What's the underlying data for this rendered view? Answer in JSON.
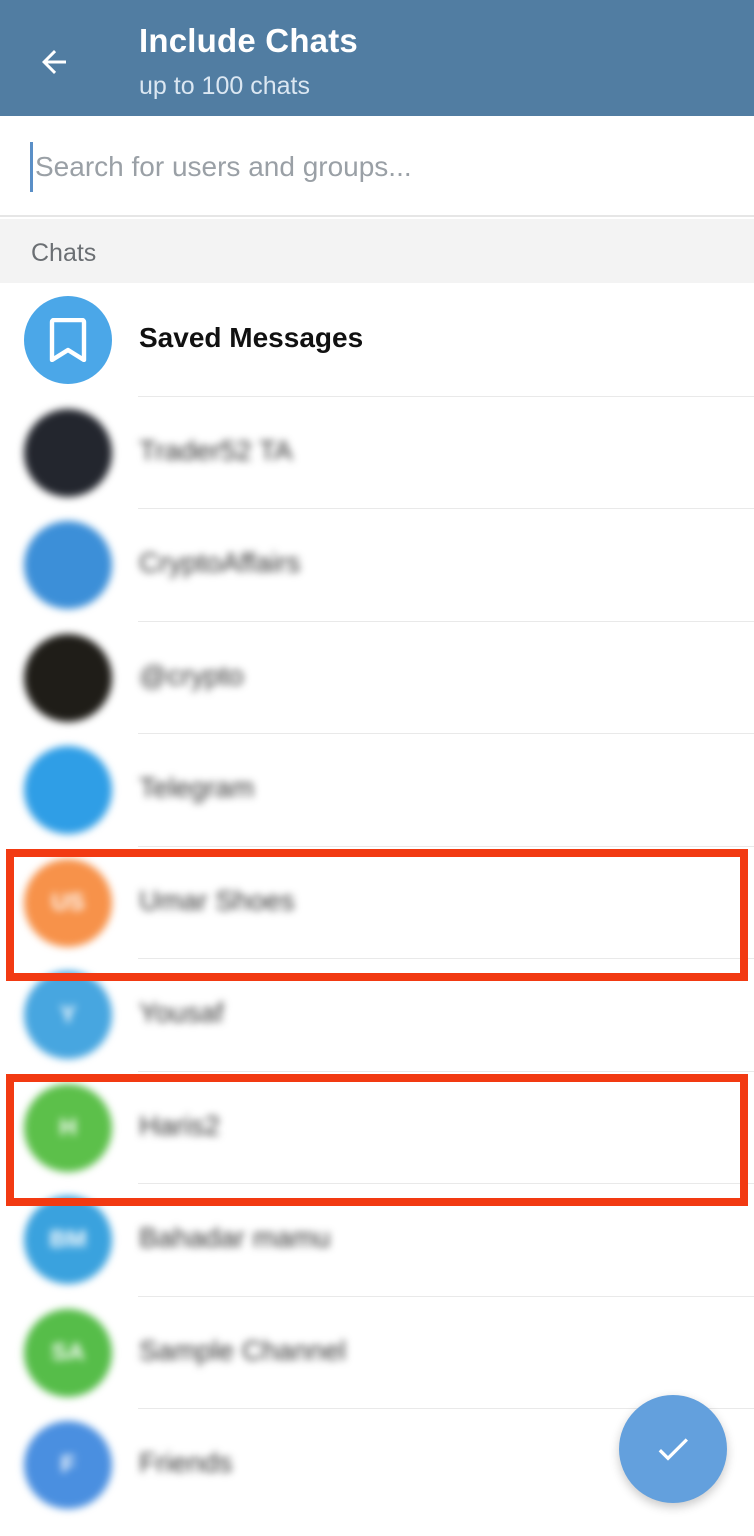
{
  "header": {
    "title": "Include Chats",
    "subtitle": "up to 100 chats",
    "back_icon": "arrow-left-icon",
    "background_color": "#517da2"
  },
  "search": {
    "placeholder": "Search for users and groups..."
  },
  "section": {
    "title": "Chats"
  },
  "chats": [
    {
      "name": "Saved Messages",
      "avatar_initials": "",
      "avatar_icon": "bookmark-icon",
      "avatar_color": "#4ba7e8",
      "blurred": false,
      "highlighted": false
    },
    {
      "name": "Trader52 TA",
      "avatar_initials": "",
      "avatar_color": "#23262e",
      "blurred": true,
      "highlighted": false
    },
    {
      "name": "CryptoAffairs",
      "avatar_initials": "",
      "avatar_color": "#3c8fd8",
      "blurred": true,
      "highlighted": false
    },
    {
      "name": "@crypto",
      "avatar_initials": "",
      "avatar_color": "#1f1d18",
      "blurred": true,
      "highlighted": false
    },
    {
      "name": "Telegram",
      "avatar_initials": "",
      "avatar_color": "#2f9ee6",
      "blurred": true,
      "highlighted": false
    },
    {
      "name": "Umar Shoes",
      "avatar_initials": "US",
      "avatar_color": "#f7924a",
      "blurred": true,
      "highlighted": true
    },
    {
      "name": "Yousaf",
      "avatar_initials": "Y",
      "avatar_color": "#47a6e0",
      "blurred": true,
      "highlighted": false
    },
    {
      "name": "Haris2",
      "avatar_initials": "H",
      "avatar_color": "#5cc04a",
      "blurred": true,
      "highlighted": true
    },
    {
      "name": "Bahadar mamu",
      "avatar_initials": "BM",
      "avatar_color": "#3aa2de",
      "blurred": true,
      "highlighted": false
    },
    {
      "name": "Sample Channel",
      "avatar_initials": "SA",
      "avatar_color": "#56bd49",
      "blurred": true,
      "highlighted": false
    },
    {
      "name": "Friends",
      "avatar_initials": "F",
      "avatar_color": "#4a8fe0",
      "blurred": true,
      "highlighted": false
    }
  ],
  "fab": {
    "icon": "checkmark-icon",
    "color": "#63a0dd"
  },
  "highlight_color": "#f23a12"
}
